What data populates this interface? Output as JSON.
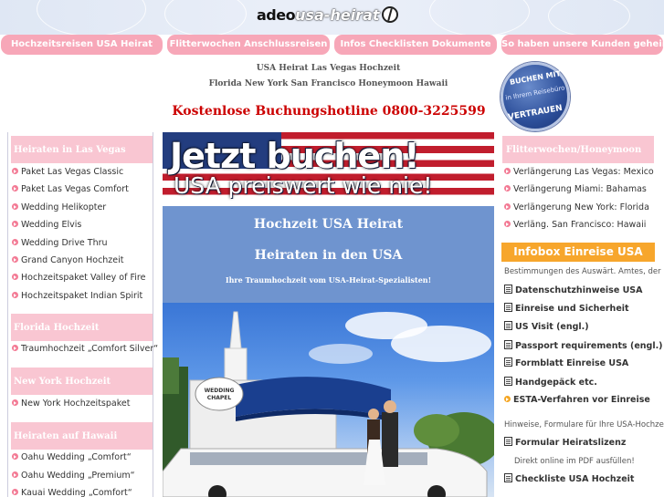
{
  "header": {
    "logo_part1": "adeo",
    "logo_part2": "usa-heirat"
  },
  "nav": [
    {
      "label": "Hochzeitsreisen USA Heirat"
    },
    {
      "label": "Flitterwochen Anschlussreisen"
    },
    {
      "label": "Infos Checklisten Dokumente"
    },
    {
      "label": "So haben unsere Kunden geheiratet"
    }
  ],
  "intro": {
    "line1": "USA Heirat Las Vegas Hochzeit",
    "line2": "Florida New York San Francisco Honeymoon Hawaii",
    "hotline": "Kostenlose Buchungshotline 0800-3225599"
  },
  "badge": {
    "top": "BUCHEN MIT",
    "middle": "in Ihrem Reisebüro",
    "bottom": "VERTRAUEN"
  },
  "left_sidebar": {
    "sections": [
      {
        "title": "Heiraten in Las Vegas",
        "items": [
          "Paket Las Vegas Classic",
          "Paket Las Vegas Comfort",
          "Wedding Helikopter",
          "Wedding Elvis",
          "Wedding Drive Thru",
          "Grand Canyon Hochzeit",
          "Hochzeitspaket Valley of Fire",
          "Hochzeitspaket Indian Spirit"
        ]
      },
      {
        "title": "Florida Hochzeit",
        "items": [
          "Traumhochzeit „Comfort Silver“"
        ]
      },
      {
        "title": "New York Hochzeit",
        "items": [
          "New York Hochzeitspaket"
        ]
      },
      {
        "title": "Heiraten auf Hawaii",
        "items": [
          "Oahu Wedding „Comfort“",
          "Oahu Wedding „Premium“",
          "Kauai Wedding „Comfort“"
        ]
      }
    ]
  },
  "banner": {
    "headline": "Jetzt buchen!",
    "subline": "USA preiswert wie nie!"
  },
  "center": {
    "title1": "Hochzeit USA Heirat",
    "title2": "Heiraten in den USA",
    "tagline": "Ihre Traumhochzeit vom USA-Heirat-Spezialisten!",
    "chapel_sign": "WEDDING CHAPEL"
  },
  "right_sidebar": {
    "honeymoon_title": "Flitterwochen/Honeymoon",
    "honeymoon_items": [
      "Verlängerung Las Vegas: Mexico",
      "Verlängerung Miami: Bahamas",
      "Verlängerung New York: Florida",
      "Verläng. San Francisco: Hawaii"
    ],
    "infobox_title": "Infobox Einreise USA",
    "infobox_note": "Bestimmungen des Auswärt. Amtes, der EU",
    "doc_links": [
      "Datenschutzhinweise USA",
      "Einreise und Sicherheit",
      "US Visit (engl.)",
      "Passport requirements (engl.)",
      "Formblatt Einreise USA",
      "Handgepäck etc."
    ],
    "esta_link": "ESTA-Verfahren vor Einreise",
    "forms_note": "Hinweise, Formulare für Ihre USA-Hochzeit",
    "form_link1": "Formular Heiratslizenz",
    "form_link1_note": "Direkt online im PDF ausfüllen!",
    "form_link2": "Checkliste USA Hochzeit"
  }
}
